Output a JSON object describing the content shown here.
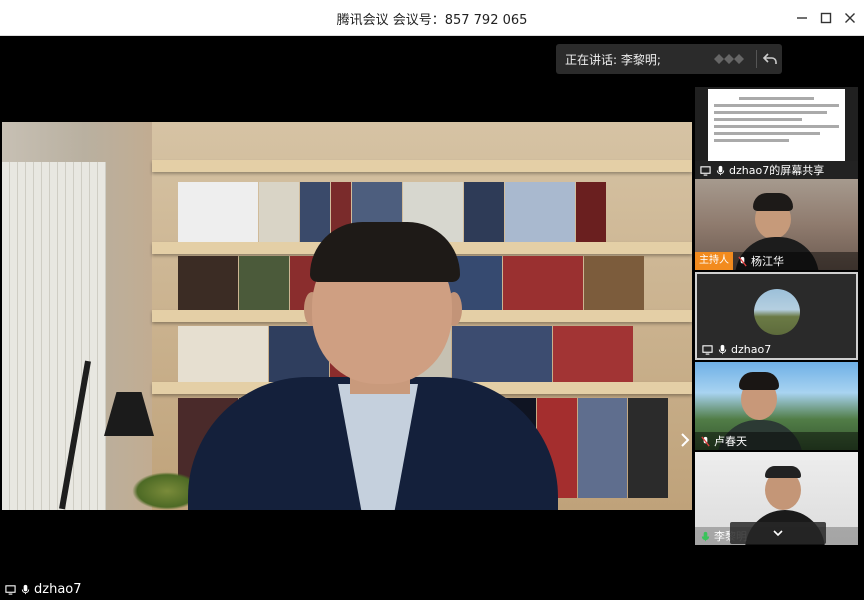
{
  "window": {
    "title": "腾讯会议 会议号：857 792 065"
  },
  "speaking": {
    "label": "正在讲话: 李黎明;"
  },
  "main_video": {
    "participant_name": "dzhao7"
  },
  "participants": {
    "screen_share_label": "dzhao7的屏幕共享",
    "host_badge": "主持人",
    "host_name": "杨江华",
    "dzhao7": "dzhao7",
    "lu": "卢春天",
    "li": "李黎明"
  },
  "colors": {
    "host_badge": "#f28b1e",
    "mic_active": "#3bc35b",
    "mic_muted": "#e04040"
  }
}
